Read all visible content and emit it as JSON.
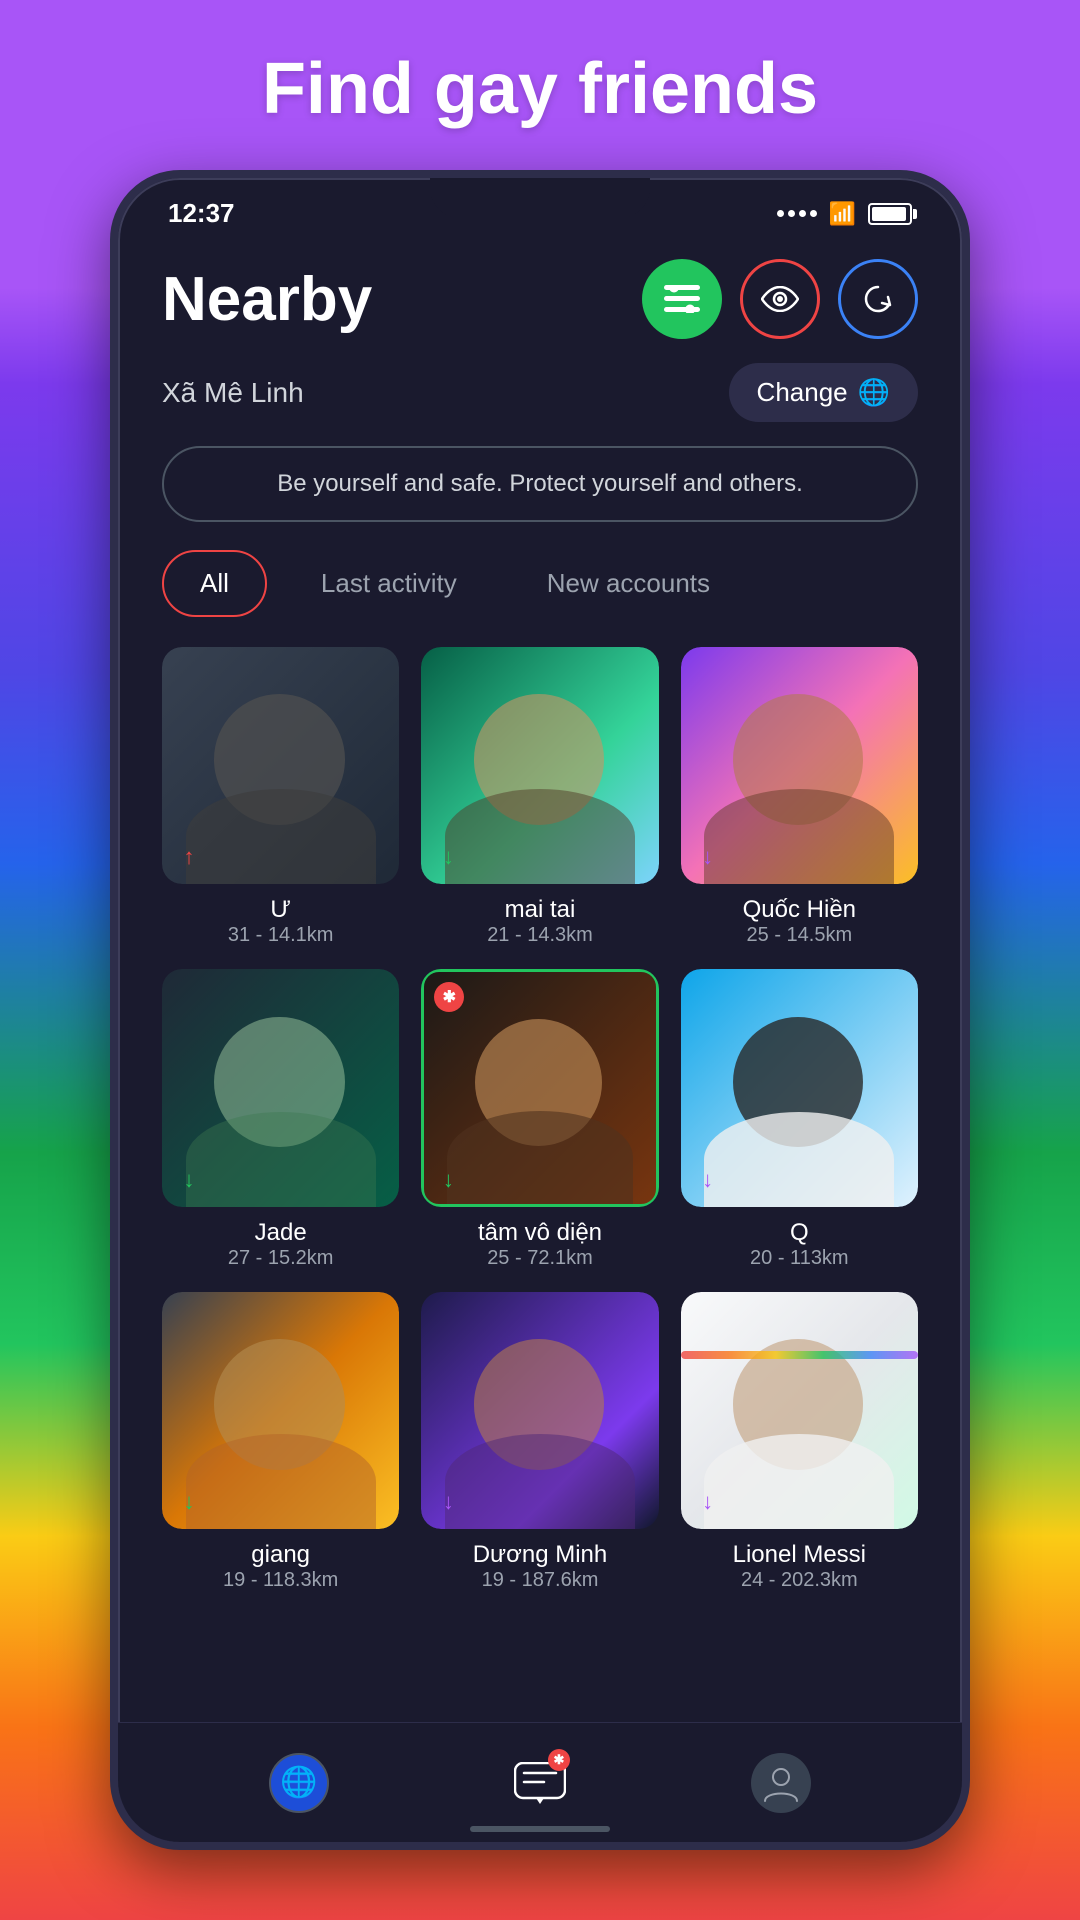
{
  "page": {
    "title": "Find gay friends",
    "background_gradient": "rainbow"
  },
  "status_bar": {
    "time": "12:37"
  },
  "header": {
    "title": "Nearby",
    "location": "Xã Mê Linh",
    "change_button": "Change",
    "safety_message": "Be yourself and safe. Protect yourself and others."
  },
  "filter_tabs": [
    {
      "id": "all",
      "label": "All",
      "active": true
    },
    {
      "id": "last_activity",
      "label": "Last activity",
      "active": false
    },
    {
      "id": "new_accounts",
      "label": "New accounts",
      "active": false
    }
  ],
  "buttons": {
    "filter": "≡",
    "eye": "👁",
    "refresh": "↺",
    "change": "Change"
  },
  "profiles": [
    {
      "id": 1,
      "name": "Ư",
      "age": 31,
      "distance": "14.1km",
      "img_class": "img-u",
      "arrow": "up",
      "arrow_color": "red"
    },
    {
      "id": 2,
      "name": "mai tai",
      "age": 21,
      "distance": "14.3km",
      "img_class": "img-mai",
      "arrow": "down",
      "arrow_color": "green"
    },
    {
      "id": 3,
      "name": "Quốc Hiền",
      "age": 25,
      "distance": "14.5km",
      "img_class": "img-quoc",
      "arrow": "down",
      "arrow_color": "purple"
    },
    {
      "id": 4,
      "name": "Jade",
      "age": 27,
      "distance": "15.2km",
      "img_class": "img-jade",
      "arrow": "down",
      "arrow_color": "green"
    },
    {
      "id": 5,
      "name": "tâm vô diện",
      "age": 25,
      "distance": "72.1km",
      "img_class": "img-tam",
      "arrow": "down",
      "arrow_color": "green",
      "border": "green",
      "new_badge": true
    },
    {
      "id": 6,
      "name": "Q",
      "age": 20,
      "distance": "113km",
      "img_class": "img-q",
      "arrow": "down",
      "arrow_color": "purple"
    },
    {
      "id": 7,
      "name": "giang",
      "age": 19,
      "distance": "118.3km",
      "img_class": "img-giang",
      "arrow": "down",
      "arrow_color": "green"
    },
    {
      "id": 8,
      "name": "Dương Minh",
      "age": 19,
      "distance": "187.6km",
      "img_class": "img-duong",
      "arrow": "down",
      "arrow_color": "purple"
    },
    {
      "id": 9,
      "name": "Lionel Messi",
      "age": 24,
      "distance": "202.3km",
      "img_class": "img-lionel",
      "arrow": "down",
      "arrow_color": "purple"
    }
  ],
  "bottom_nav": [
    {
      "id": "nearby",
      "icon": "globe",
      "label": "Nearby",
      "active": true
    },
    {
      "id": "messages",
      "icon": "message",
      "label": "Messages",
      "badge": "*"
    },
    {
      "id": "profile",
      "icon": "person",
      "label": "Profile",
      "active": false
    }
  ]
}
